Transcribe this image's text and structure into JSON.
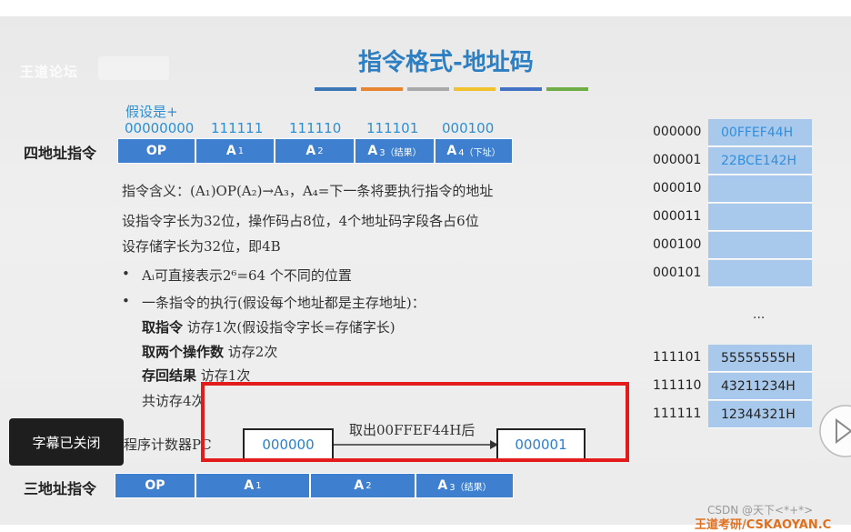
{
  "watermark": {
    "text": "王道论坛"
  },
  "slide": {
    "title": "指令格式-地址码",
    "color_bar": [
      "#3c77b8",
      "#e88532",
      "#a9a9a9",
      "#f2c12e",
      "#4472c4",
      "#70ad47"
    ]
  },
  "four_addr": {
    "label": "四地址指令",
    "assume": "假设是+",
    "codes": [
      "00000000",
      "111111",
      "111110",
      "111101",
      "000100"
    ],
    "fields": [
      {
        "main": "OP",
        "sub": ""
      },
      {
        "main": "A",
        "sub": "1"
      },
      {
        "main": "A",
        "sub": "2"
      },
      {
        "main": "A",
        "sub": "3（结果）"
      },
      {
        "main": "A",
        "sub": "4（下址）"
      }
    ]
  },
  "text": {
    "meaning": "指令含义：(A₁)OP(A₂)→A₃，A₄=下一条将要执行指令的地址",
    "wordlen": "设指令字长为32位，操作码占8位，4个地址码字段各占6位",
    "storage": "设存储字长为32位，即4B",
    "bullet1": "Aᵢ可直接表示2⁶=64 个不同的位置",
    "bullet2": "一条指令的执行(假设每个地址都是主存地址)：",
    "fetch_bold": "取指令",
    "fetch_rest": " 访存1次(假设指令字长=存储字长)",
    "ops_bold": "取两个操作数",
    "ops_rest": " 访存2次",
    "store_bold": "存回结果",
    "store_rest": " 访存1次",
    "total": "共访存4次"
  },
  "pc": {
    "label": "程序计数器PC",
    "value_before": "000000",
    "action": "取出00FFEF44H后",
    "value_after": "000001"
  },
  "three_addr": {
    "label": "三地址指令",
    "fields": [
      {
        "main": "OP",
        "sub": ""
      },
      {
        "main": "A",
        "sub": "1"
      },
      {
        "main": "A",
        "sub": "2"
      },
      {
        "main": "A",
        "sub": "3（结果）"
      }
    ]
  },
  "memory": {
    "top_rows": [
      {
        "addr": "000000",
        "value": "00FFEF44H"
      },
      {
        "addr": "000001",
        "value": "22BCE142H"
      },
      {
        "addr": "000010",
        "value": ""
      },
      {
        "addr": "000011",
        "value": ""
      },
      {
        "addr": "000100",
        "value": ""
      },
      {
        "addr": "000101",
        "value": ""
      }
    ],
    "ellipsis": "...",
    "bottom_rows": [
      {
        "addr": "111101",
        "value": "55555555H"
      },
      {
        "addr": "111110",
        "value": "43211234H"
      },
      {
        "addr": "111111",
        "value": "12344321H"
      }
    ]
  },
  "overlay": {
    "caption_off": "字幕已关闭",
    "csdn": "CSDN @天下<*+*>",
    "footer_brand": "王道考研/CSKAOYAN.C"
  }
}
